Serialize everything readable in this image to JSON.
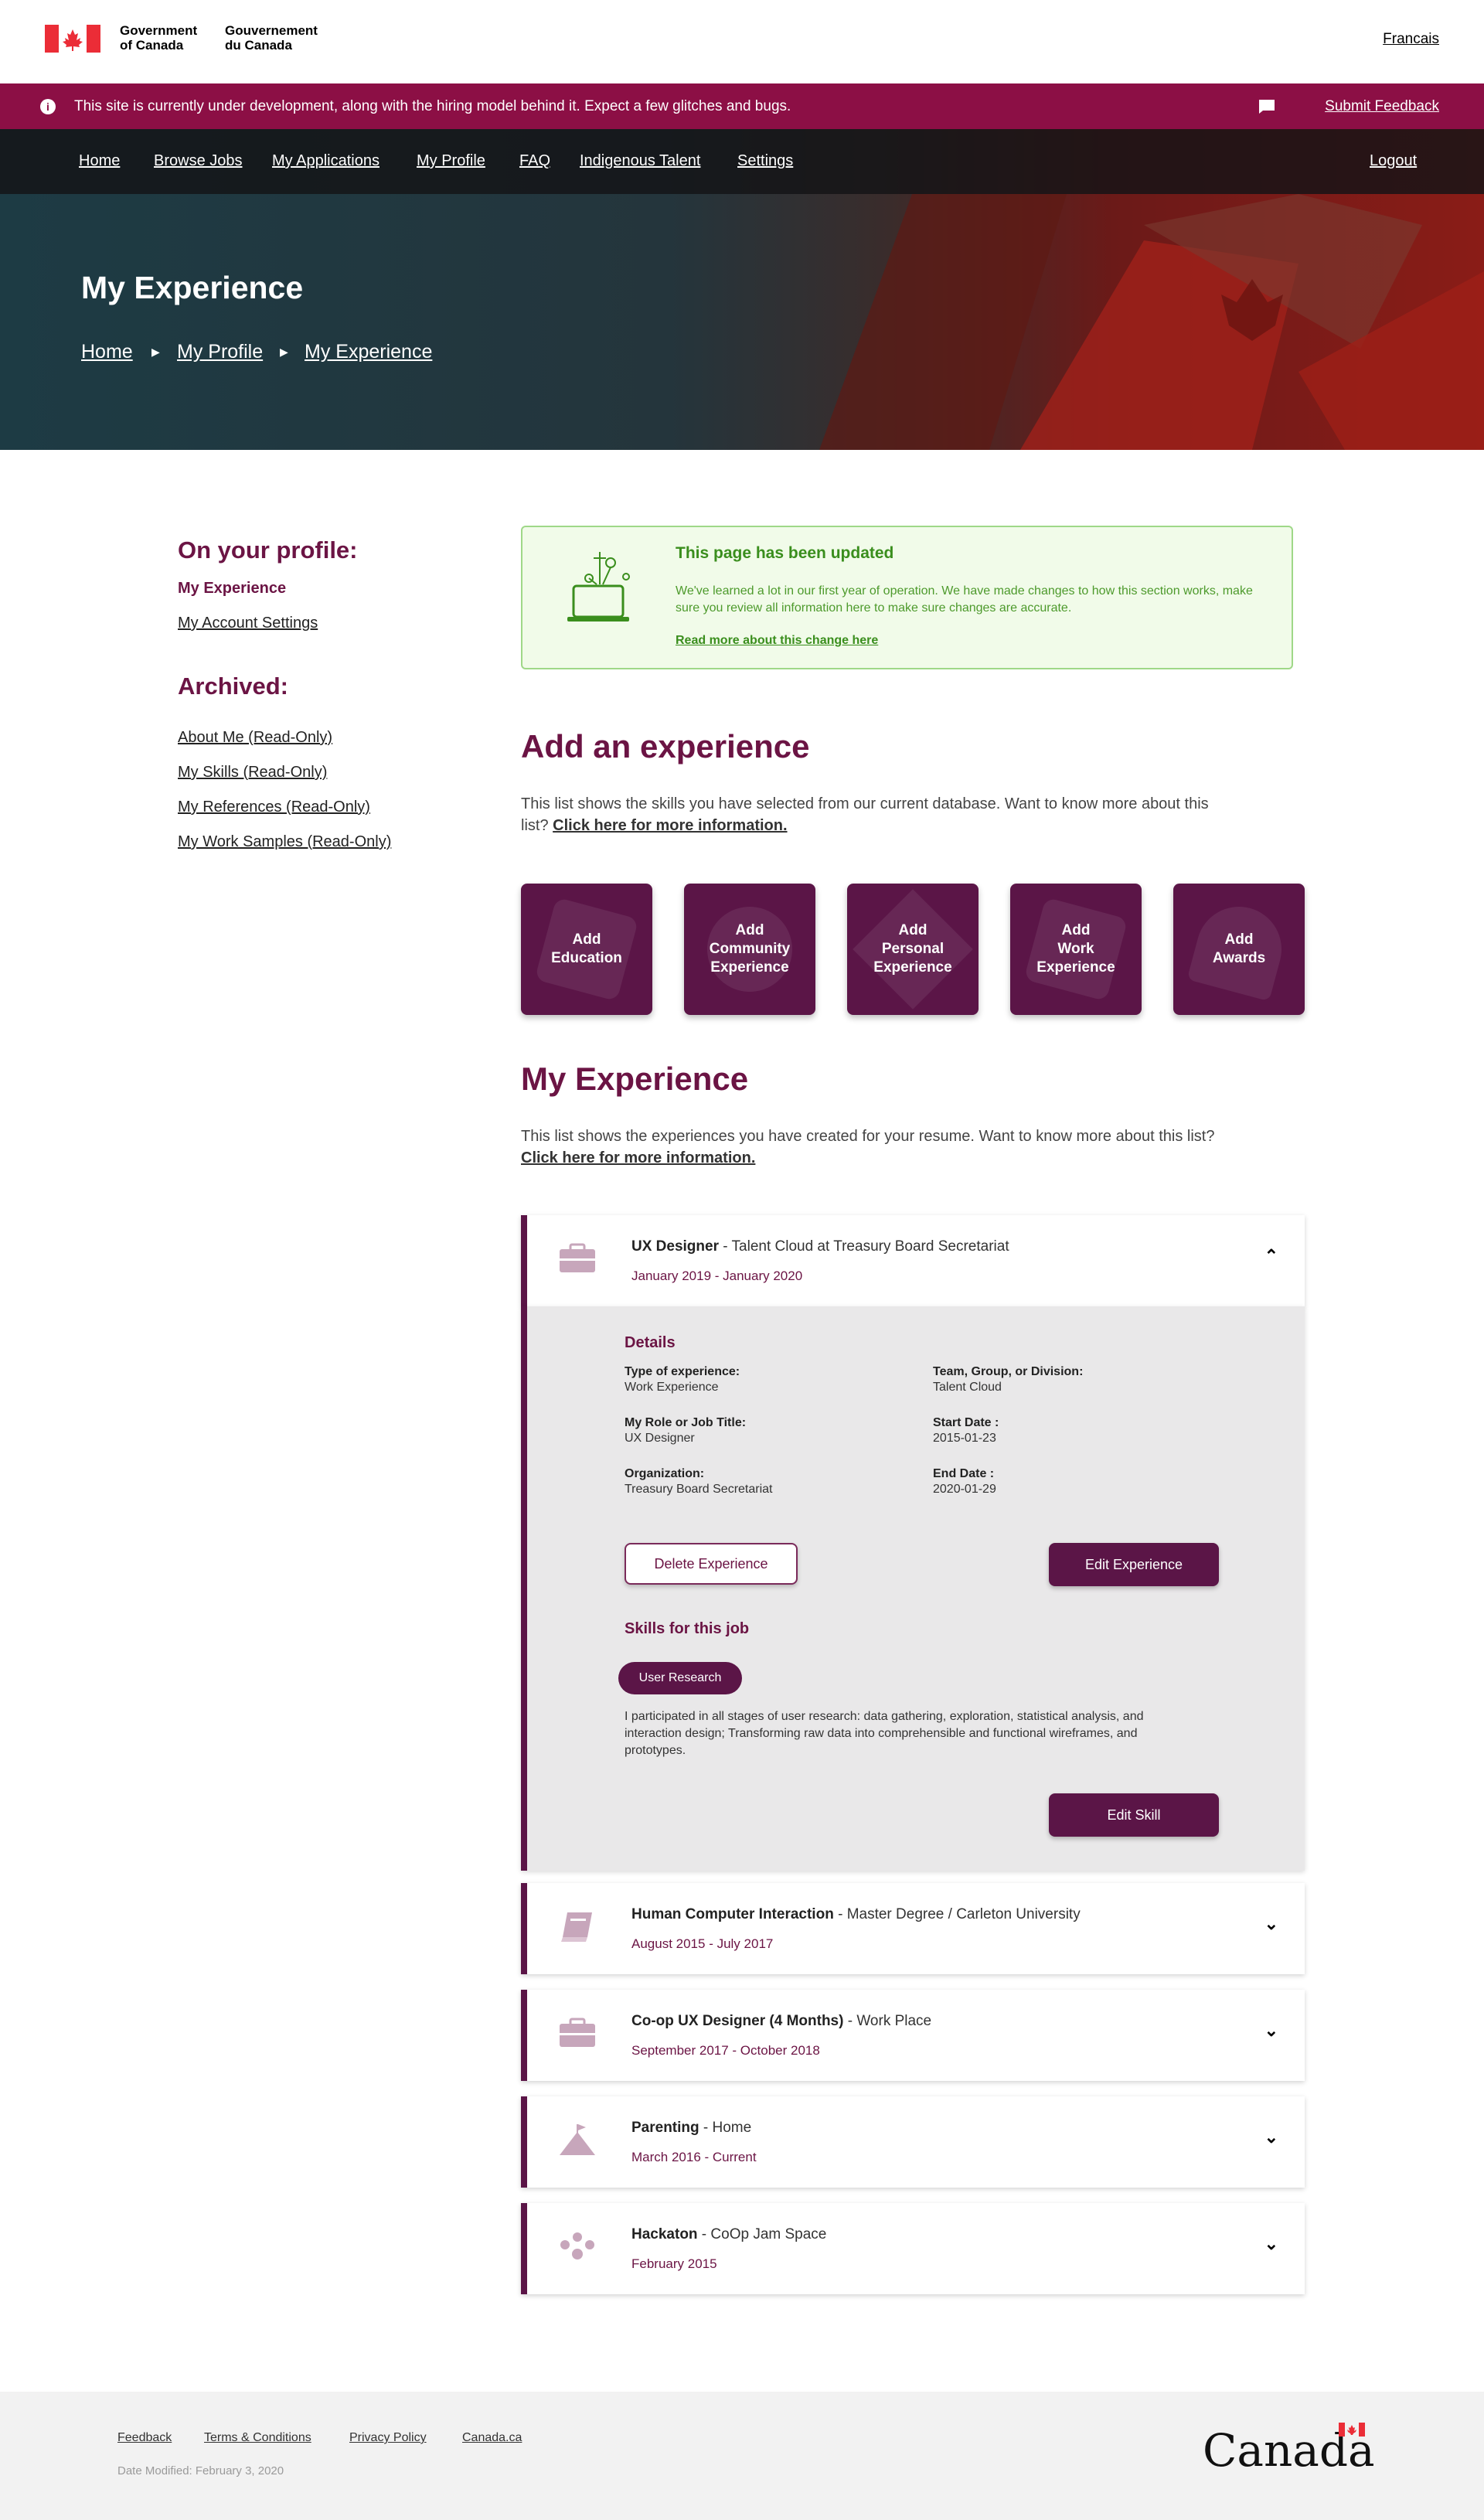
{
  "gov": {
    "en": "Government\nof Canada",
    "fr": "Gouvernement\ndu Canada",
    "lang": "Francais"
  },
  "alert": {
    "message": "This site is currently under development, along with the hiring model behind it. Expect a few glitches and bugs.",
    "feedback": "Submit Feedback"
  },
  "nav": {
    "items": [
      "Home",
      "Browse Jobs",
      "My Applications",
      "My Profile",
      "FAQ",
      "Indigenous Talent",
      "Settings"
    ],
    "logout": "Logout"
  },
  "hero": {
    "title": "My Experience",
    "breadcrumb": [
      "Home",
      "My Profile",
      "My Experience"
    ]
  },
  "sidebar": {
    "profile_heading": "On your profile:",
    "profile_items": [
      "My Experience",
      "My Account Settings"
    ],
    "archived_heading": "Archived:",
    "archived_items": [
      "About Me (Read-Only)",
      "My Skills (Read-Only)",
      "My References (Read-Only)",
      "My Work Samples (Read-Only)"
    ]
  },
  "notice": {
    "title": "This page has been updated",
    "body": "We've learned a lot in our first year of operation. We have made changes to how this section works, make sure you review all information here to make sure changes are accurate.",
    "link": "Read more about this change here"
  },
  "add": {
    "heading": "Add an experience",
    "text": "This list shows the skills you have selected from our current database. Want to know more about this list?",
    "link": "Click here for more information.",
    "tiles": [
      "Add\nEducation",
      "Add\nCommunity\nExperience",
      "Add\nPersonal\nExperience",
      "Add\nWork\nExperience",
      "Add\nAwards"
    ]
  },
  "experience": {
    "heading": "My Experience",
    "text": "This list shows the experiences  you have created for your resume. Want to know more about this list?",
    "link": "Click here for more information.",
    "expanded": {
      "title": "UX Designer",
      "subtitle": " - Talent Cloud at Treasury Board Secretariat",
      "date": "January 2019 - January 2020",
      "chevron": "⌃",
      "details_heading": "Details",
      "labels": {
        "type": "Type of experience:",
        "team": "Team, Group, or Division:",
        "role": "My Role or Job Title:",
        "start": "Start Date :",
        "org": "Organization:",
        "end": "End Date :"
      },
      "values": {
        "type": "Work Experience",
        "team": "Talent Cloud",
        "role": "UX Designer",
        "start": "2015-01-23",
        "org": "Treasury Board Secretariat",
        "end": "2020-01-29"
      },
      "delete_button": "Delete Experience",
      "edit_button": "Edit Experience",
      "skills_heading": "Skills for this job",
      "skill": "User Research",
      "skill_text": "I participated in all stages of user research: data gathering, exploration, statistical analysis, and interaction design; Transforming raw data into comprehensible and functional wireframes, and prototypes.",
      "edit_skill": "Edit Skill"
    },
    "items": [
      {
        "title": "Human Computer Interaction",
        "subtitle": " - Master Degree / Carleton University",
        "date": "August 2015 - July 2017",
        "icon": "book-icon"
      },
      {
        "title": "Co-op UX Designer (4 Months)",
        "subtitle": " - Work Place",
        "date": "September 2017 - October 2018",
        "icon": "briefcase-icon"
      },
      {
        "title": "Parenting",
        "subtitle": " - Home",
        "date": "March 2016 - Current",
        "icon": "mountain-flag-icon"
      },
      {
        "title": "Hackaton",
        "subtitle": " - CoOp Jam Space",
        "date": "February 2015",
        "icon": "people-icon"
      }
    ],
    "collapsed_chevron": "⌄"
  },
  "footer": {
    "links": [
      "Feedback",
      "Terms & Conditions",
      "Privacy Policy",
      "Canada.ca"
    ],
    "modified": "Date Modified: February 3, 2020",
    "wordmark": "Canada"
  },
  "colors": {
    "brand": "#5b1547",
    "alert": "#8c0f45",
    "success": "#3a8e1d"
  }
}
